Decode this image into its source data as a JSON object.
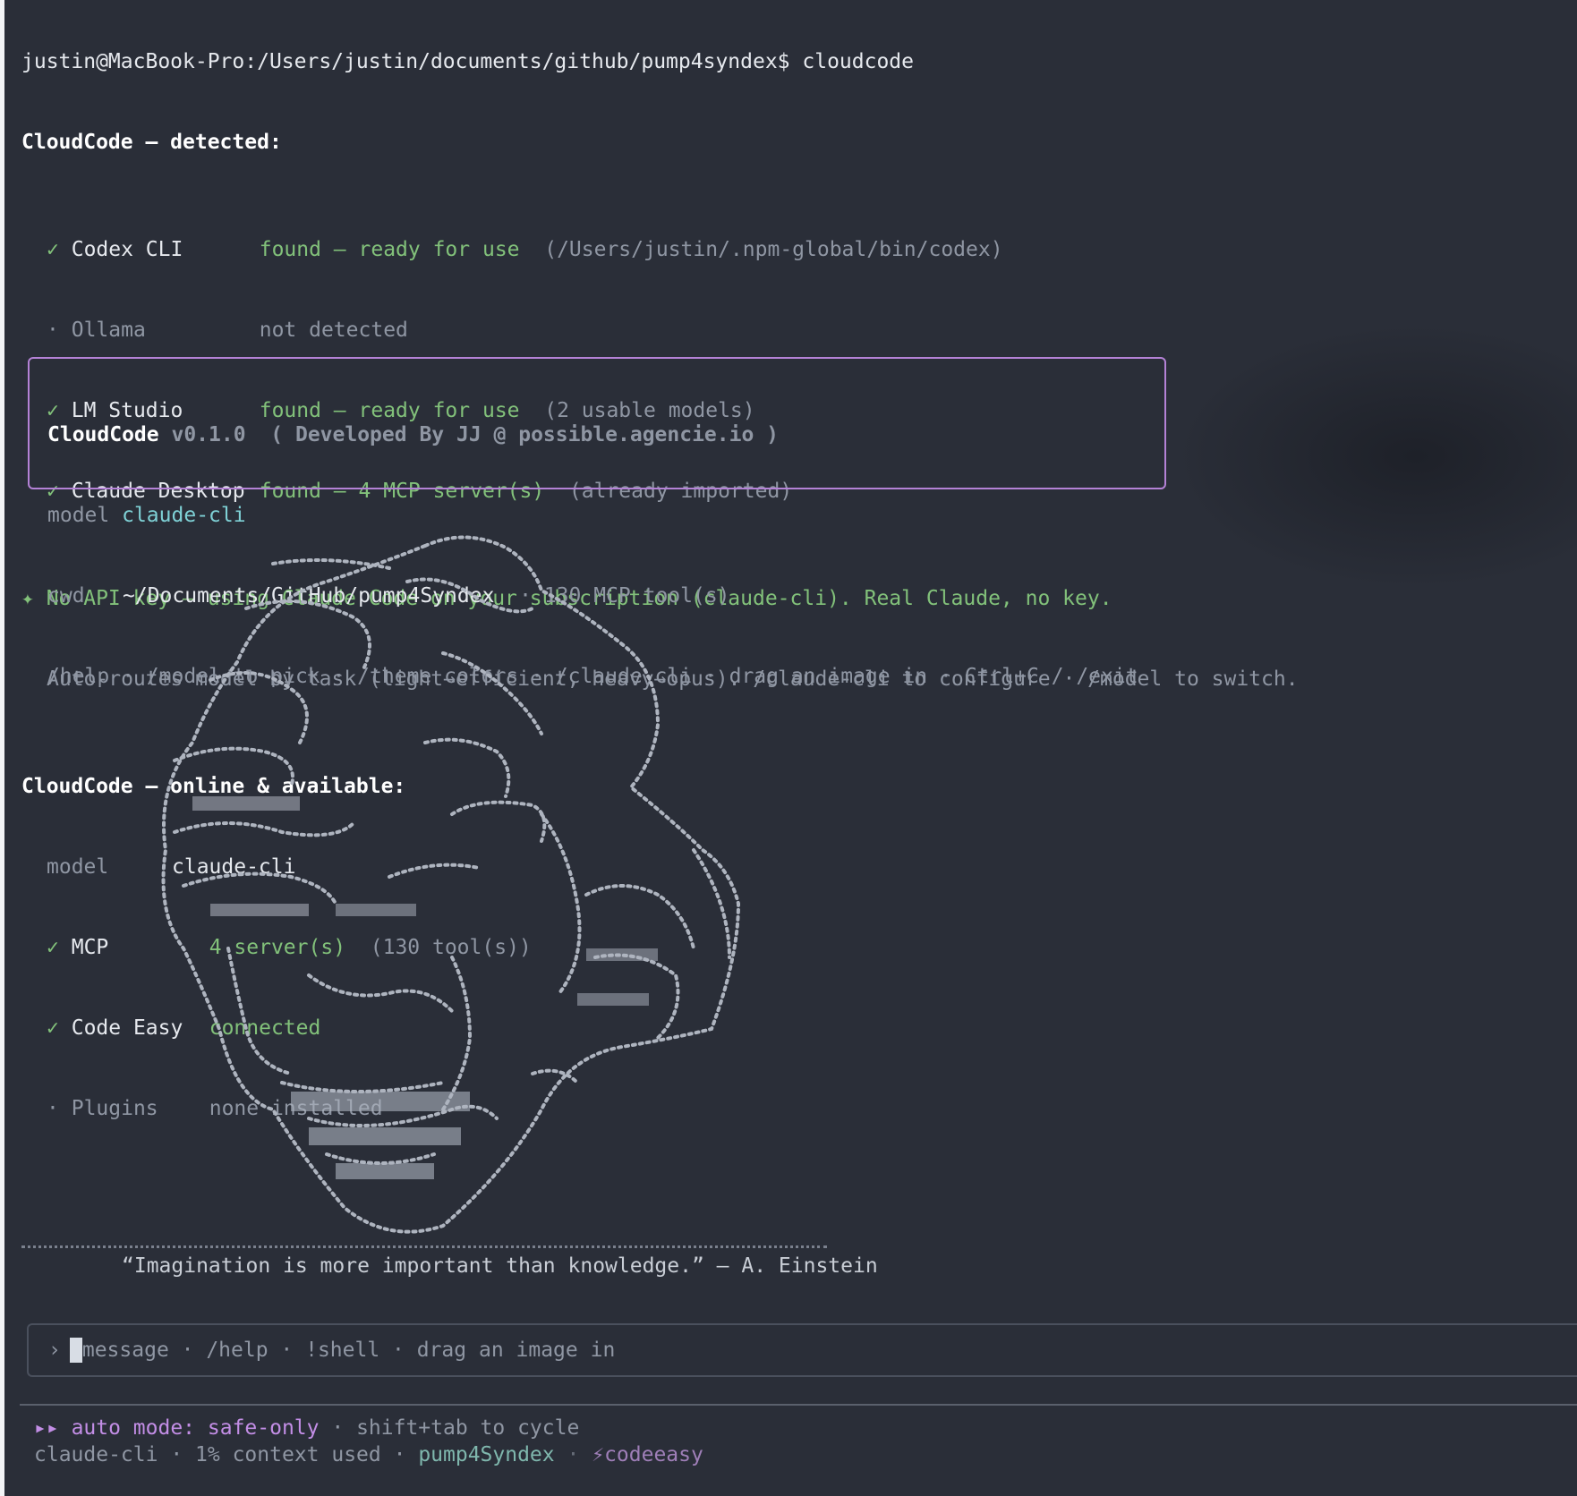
{
  "shell": {
    "command_line": "justin@MacBook-Pro:/Users/justin/documents/github/pump4syndex$ cloudcode"
  },
  "detected": {
    "heading": "CloudCode — detected:",
    "items": [
      {
        "mark": "✓",
        "name": "Codex CLI",
        "status": "found — ready for use",
        "note": "(/Users/justin/.npm-global/bin/codex)"
      },
      {
        "mark": "·",
        "name": "Ollama",
        "status": "not detected",
        "note": ""
      },
      {
        "mark": "✓",
        "name": "LM Studio",
        "status": "found — ready for use",
        "note": "(2 usable models)"
      },
      {
        "mark": "✓",
        "name": "Claude Desktop",
        "status": "found — 4 MCP server(s)",
        "note": "(already imported)"
      }
    ],
    "notice": "✦ No API key — using Claude Code on your subscription (claude-cli). Real Claude, no key.",
    "notice_detail": "Auto-routes model by task (light→efficient, heavy→opus). /claude-cli to configure · /model to switch."
  },
  "online": {
    "heading": "CloudCode — online & available:",
    "model_label": "model",
    "model_value": "claude-cli",
    "items": [
      {
        "mark": "✓",
        "name": "MCP",
        "status": "4 server(s)",
        "note": "(130 tool(s))"
      },
      {
        "mark": "✓",
        "name": "Code Easy",
        "status": "connected",
        "note": ""
      },
      {
        "mark": "·",
        "name": "Plugins",
        "status": "none installed",
        "note": ""
      }
    ]
  },
  "card": {
    "app": "CloudCode",
    "version": "v0.1.0",
    "credit": "( Developed By JJ @ possible.agencie.io )",
    "model_label": "model",
    "model_value": "claude-cli",
    "cwd_label": "cwd",
    "cwd_value": "~/Documents/GitHub/pump4Syndex",
    "tools": "· 130 MCP tool(s)",
    "hints": "/help · /model to pick · /theme colors · /claude-cli · drag an image in · Ctrl+C / /exit"
  },
  "quote": "“Imagination is more important than knowledge.” — A. Einstein",
  "input": {
    "prompt_symbol": "›",
    "placeholder": "message · /help · !shell · drag an image in"
  },
  "status": {
    "mode_icon": "▸▸",
    "mode_label": "auto mode: safe-only",
    "mode_hint": "· shift+tab to cycle",
    "model": "claude-cli",
    "context": "· 1% context used ·",
    "project": "pump4Syndex",
    "sep": "·",
    "brand": "⚡codeeasy"
  },
  "colors": {
    "background": "#2a2e38",
    "success": "#82c17a",
    "muted": "#8f96a3",
    "accent_cyan": "#7fd1d6",
    "accent_purple": "#c38ee6",
    "card_border": "#b482d6"
  }
}
